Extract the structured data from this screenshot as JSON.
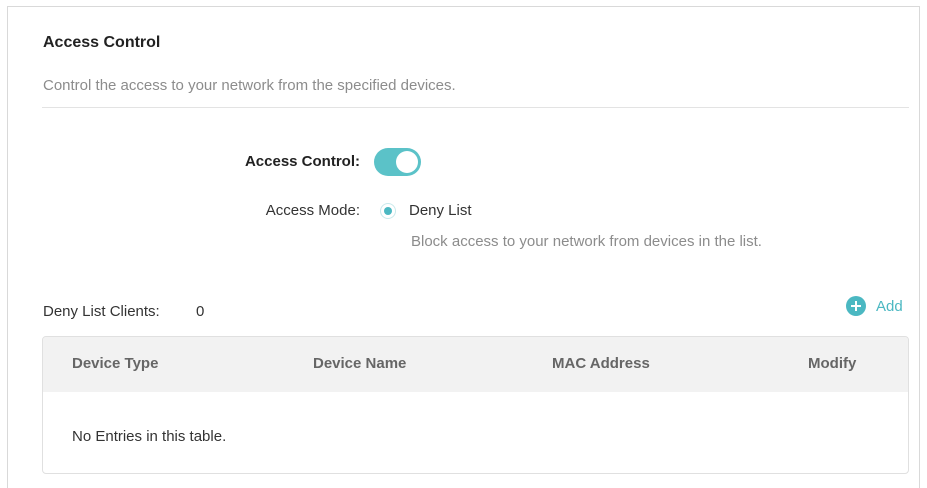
{
  "section": {
    "title": "Access Control",
    "description": "Control the access to your network from the specified devices."
  },
  "access_control": {
    "label": "Access Control:",
    "enabled": true
  },
  "access_mode": {
    "label": "Access Mode:",
    "option": "Deny List",
    "selected": true,
    "option_description": "Block access to your network from devices in the list."
  },
  "clients": {
    "label": "Deny List Clients:",
    "count": "0",
    "add_label": "Add"
  },
  "table": {
    "columns": [
      "Device Type",
      "Device Name",
      "MAC Address",
      "Modify"
    ],
    "empty_message": "No Entries in this table."
  },
  "colors": {
    "accent": "#4bb8c2",
    "toggle_on": "#5bc2c8",
    "header_bg": "#f2f2f2"
  },
  "icons": {
    "add": "plus-circle-icon"
  }
}
